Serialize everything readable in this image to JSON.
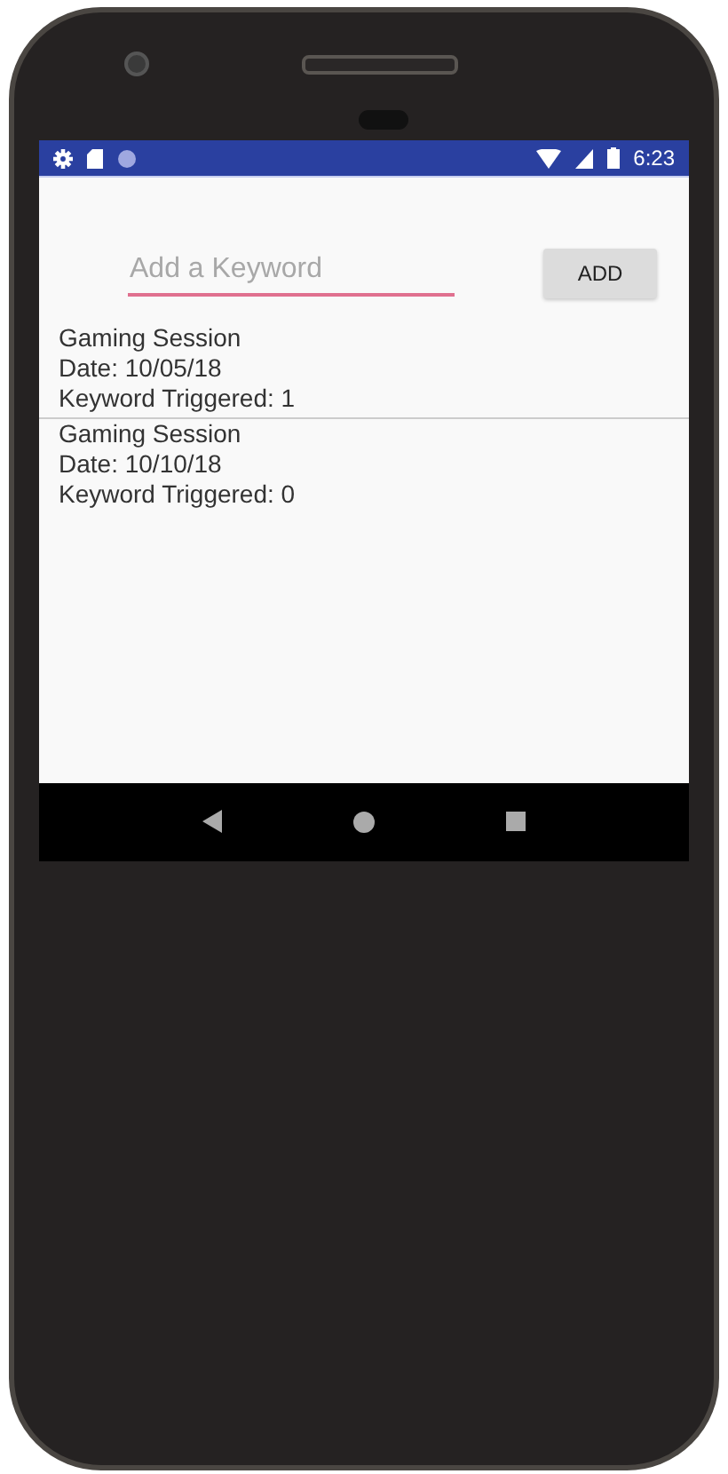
{
  "status_bar": {
    "time": "6:23"
  },
  "keyword_field": {
    "placeholder": "Add a Keyword"
  },
  "add_button": {
    "label": "ADD"
  },
  "sessions": [
    {
      "title": "Gaming Session",
      "date": "Date: 10/05/18",
      "triggered": "Keyword Triggered: 1"
    },
    {
      "title": "Gaming Session",
      "date": "Date: 10/10/18",
      "triggered": "Keyword Triggered: 0"
    }
  ]
}
